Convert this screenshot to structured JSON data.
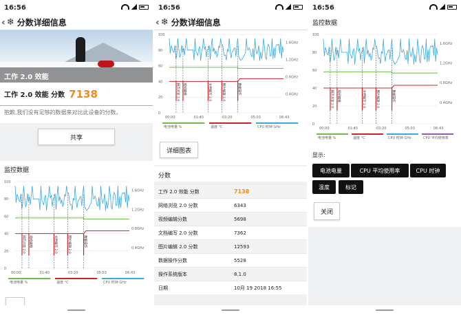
{
  "status": {
    "time": "16:56"
  },
  "page_title": "分数详细信息",
  "hero": {
    "label": "工作 2.0 效能",
    "label_suffix": "2.0"
  },
  "score": {
    "label": "工作 2.0 效能 分数",
    "value": "7138"
  },
  "note": "抱歉,我们没有足够的数据来对比此设备的分数。",
  "share_label": "共享",
  "monitor_title": "监控数据",
  "chart": {
    "left_ticks": [
      "100",
      "80",
      "60",
      "40",
      "20",
      "0"
    ],
    "right_ticks": [
      "1.6GHz",
      "1.2GHz",
      "0.8GHz",
      "0.4GHz"
    ],
    "x_ticks": [
      "00:00",
      "01:40",
      "03:20",
      "05:03",
      "06:43"
    ],
    "phase_labels": [
      "网页浏览 2.0",
      "视频编辑",
      "文档编写 2.0",
      "图片编辑 2.0",
      "数据操作"
    ],
    "legend": [
      "电池电量 %",
      "温度 °C",
      "CPU 时钟 GHz",
      "CPU 平均使用率"
    ],
    "colors": {
      "battery": "#6cbd45",
      "temp": "#c8262b",
      "clock": "#3ba7df",
      "usage": "#9b59b6"
    }
  },
  "detail_chart_btn": "详细图表",
  "scores_title": "分数",
  "scores": [
    {
      "k": "工作 2.0 效能 分数",
      "v": "7138"
    },
    {
      "k": "网络浏览 2.0 分数",
      "v": "6343"
    },
    {
      "k": "视频编辑分数",
      "v": "5698"
    },
    {
      "k": "文档编写 2.0 分数",
      "v": "7362"
    },
    {
      "k": "图片编辑 2.0 分数",
      "v": "12593"
    },
    {
      "k": "数据操作分数",
      "v": "5528"
    },
    {
      "k": "操作系统版本",
      "v": "8.1.0"
    },
    {
      "k": "日期",
      "v": "10月 19 2018 16:55"
    }
  ],
  "show_label": "显示:",
  "toggles": [
    "电池电量",
    "CPU 平均使用率",
    "CPU 时钟",
    "温度",
    "标记"
  ],
  "close_label": "关闭"
}
